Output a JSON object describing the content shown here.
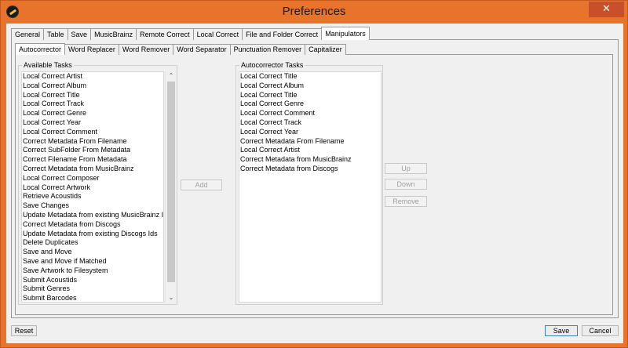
{
  "window": {
    "title": "Preferences",
    "close_glyph": "✕",
    "app_icon": "app-logo-icon"
  },
  "main_tabs": [
    {
      "label": "General"
    },
    {
      "label": "Table"
    },
    {
      "label": "Save"
    },
    {
      "label": "MusicBrainz"
    },
    {
      "label": "Remote Correct"
    },
    {
      "label": "Local Correct"
    },
    {
      "label": "File and Folder Correct"
    },
    {
      "label": "Manipulators",
      "active": true
    }
  ],
  "sub_tabs": [
    {
      "label": "Autocorrector",
      "active": true
    },
    {
      "label": "Word Replacer"
    },
    {
      "label": "Word Remover"
    },
    {
      "label": "Word Separator"
    },
    {
      "label": "Punctuation Remover"
    },
    {
      "label": "Capitalizer"
    }
  ],
  "available": {
    "label": "Available Tasks",
    "items": [
      "Local Correct Artist",
      "Local Correct Album",
      "Local Correct Title",
      "Local Correct Track",
      "Local Correct Genre",
      "Local Correct Year",
      "Local Correct Comment",
      "Correct Metadata From Filename",
      "Correct SubFolder From Metadata",
      "Correct Filename From Metadata",
      "Correct Metadata from MusicBrainz",
      "Local Correct Composer",
      "Local Correct Artwork",
      "Retrieve Acoustids",
      "Save Changes",
      "Update Metadata from existing MusicBrainz Ids",
      "Correct Metadata from Discogs",
      "Update Metadata from existing Discogs Ids",
      "Delete Duplicates",
      "Save and Move",
      "Save and Move if Matched",
      "Save Artwork to Filesystem",
      "Submit Acoustids",
      "Submit Genres",
      "Submit Barcodes"
    ],
    "scroll_up_glyph": "⌃",
    "scroll_down_glyph": "⌄"
  },
  "autocorrector": {
    "label": "Autocorrector Tasks",
    "items": [
      "Local Correct Title",
      "Local Correct Album",
      "Local Correct Title",
      "Local Correct Genre",
      "Local Correct Comment",
      "Local Correct Track",
      "Local Correct Year",
      "Correct Metadata From Filename",
      "Local Correct Artist",
      "Correct Metadata from MusicBrainz",
      "Correct Metadata from Discogs"
    ]
  },
  "buttons": {
    "add": "Add",
    "up": "Up",
    "down": "Down",
    "remove": "Remove",
    "reset": "Reset",
    "save": "Save",
    "cancel": "Cancel"
  }
}
